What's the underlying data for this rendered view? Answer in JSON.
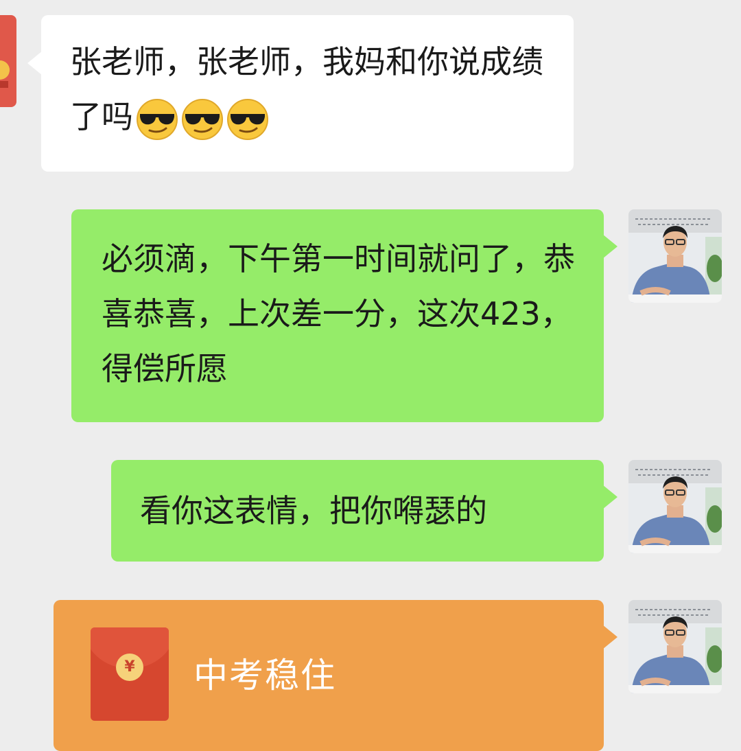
{
  "messages": [
    {
      "id": "student-message",
      "side": "left",
      "text": "张老师，张老师，我妈和你说成绩了吗",
      "emoji_name": "sunglasses-face-icon",
      "emoji_count": 3
    },
    {
      "id": "teacher-reply-1",
      "side": "right",
      "text": "必须滴，下午第一时间就问了，恭喜恭喜，上次差一分，这次423，得偿所愿"
    },
    {
      "id": "teacher-reply-2",
      "side": "right",
      "text": "看你这表情，把你嘚瑟的"
    },
    {
      "id": "red-packet",
      "side": "right",
      "type": "red-packet",
      "title": "中考稳住",
      "icon": "¥"
    }
  ],
  "colors": {
    "background": "#ededed",
    "incoming_bubble": "#ffffff",
    "outgoing_bubble": "#95ec69",
    "red_packet_bubble": "#f0a04b",
    "red_packet_envelope": "#d6472f"
  }
}
